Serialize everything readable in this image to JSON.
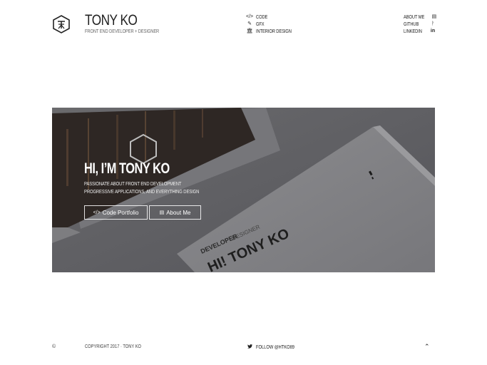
{
  "header": {
    "logo_icon": "hexagon-monogram-logo",
    "brand_name": "TONY KO",
    "brand_tagline": "FRONT END DEVELOPER + DESIGNER"
  },
  "nav_primary": [
    {
      "icon": "code-icon",
      "glyph": "</>",
      "label": "CODE"
    },
    {
      "icon": "brush-icon",
      "glyph": "✎",
      "label": "GFX"
    },
    {
      "icon": "building-icon",
      "glyph": "🏛",
      "label": "INTERIOR DESIGN"
    }
  ],
  "nav_secondary": [
    {
      "icon": "id-card-icon",
      "glyph": "▤",
      "label": "ABOUT ME"
    },
    {
      "icon": "github-icon",
      "glyph": "ᚹ",
      "label": "GITHUB"
    },
    {
      "icon": "linkedin-icon",
      "glyph": "in",
      "label": "LINKEDIN"
    }
  ],
  "hero": {
    "title": "HI, I’M TONY KO",
    "line1": "PASSIONATE ABOUT FRONT END DEVELOPMENT",
    "line2": "PROGRESSIVE APPLICATIONS, AND EVERYTHING DESIGN",
    "btn_code_icon": "</>",
    "btn_code_label": "Code Portfolio",
    "btn_about_icon": "▤",
    "btn_about_label": "About Me",
    "card_text_role": "DEVELOPER + DESIGNER",
    "card_text_name": "HI! TONY KO"
  },
  "footer": {
    "copyright_symbol": "©",
    "copyright": "COPYRIGHT 2017 · TONY KO",
    "follow_icon": "twitter-icon",
    "follow_glyph": "🐦",
    "follow_label": "FOLLOW @HTKO89",
    "scroll_top_glyph": "⌃"
  },
  "colors": {
    "text": "#222222",
    "hero_overlay": "#5f5f62",
    "white": "#ffffff"
  }
}
